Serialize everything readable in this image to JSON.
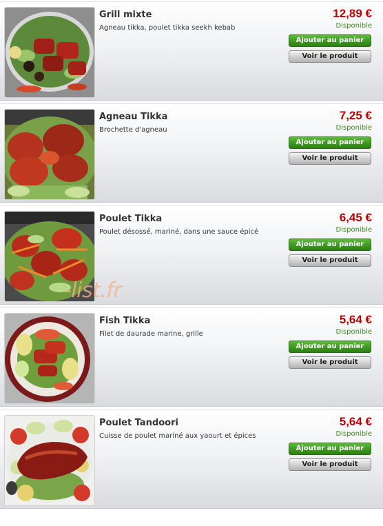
{
  "products": [
    {
      "name": "Grill mixte",
      "description": "Agneau tikka, poulet tikka seekh kebab",
      "price": "12,89 €",
      "availability": "Disponible",
      "cart_label": "Ajouter au panier",
      "view_label": "Voir le produit",
      "image_icon": "grill-mixte-photo"
    },
    {
      "name": "Agneau Tikka",
      "description": "Brochette d'agneau",
      "price": "7,25 €",
      "availability": "Disponible",
      "cart_label": "Ajouter au panier",
      "view_label": "Voir le produit",
      "image_icon": "agneau-tikka-photo"
    },
    {
      "name": "Poulet Tikka",
      "description": "Poulet désossé, mariné, dans une sauce épicé",
      "price": "6,45 €",
      "availability": "Disponible",
      "cart_label": "Ajouter au panier",
      "view_label": "Voir le produit",
      "image_icon": "poulet-tikka-photo"
    },
    {
      "name": "Fish Tikka",
      "description": "Filet de daurade marine, grille",
      "price": "5,64 €",
      "availability": "Disponible",
      "cart_label": "Ajouter au panier",
      "view_label": "Voir le produit",
      "image_icon": "fish-tikka-photo"
    },
    {
      "name": "Poulet Tandoori",
      "description": "Cuisse de poulet mariné aux yaourt et épices",
      "price": "5,64 €",
      "availability": "Disponible",
      "cart_label": "Ajouter au panier",
      "view_label": "Voir le produit",
      "image_icon": "poulet-tandoori-photo"
    }
  ],
  "watermark": "-list.fr",
  "colors": {
    "price": "#c00000",
    "availability": "#3a8a1c",
    "cart_button": "#3c9a1f",
    "view_button": "#cfcfcf"
  }
}
